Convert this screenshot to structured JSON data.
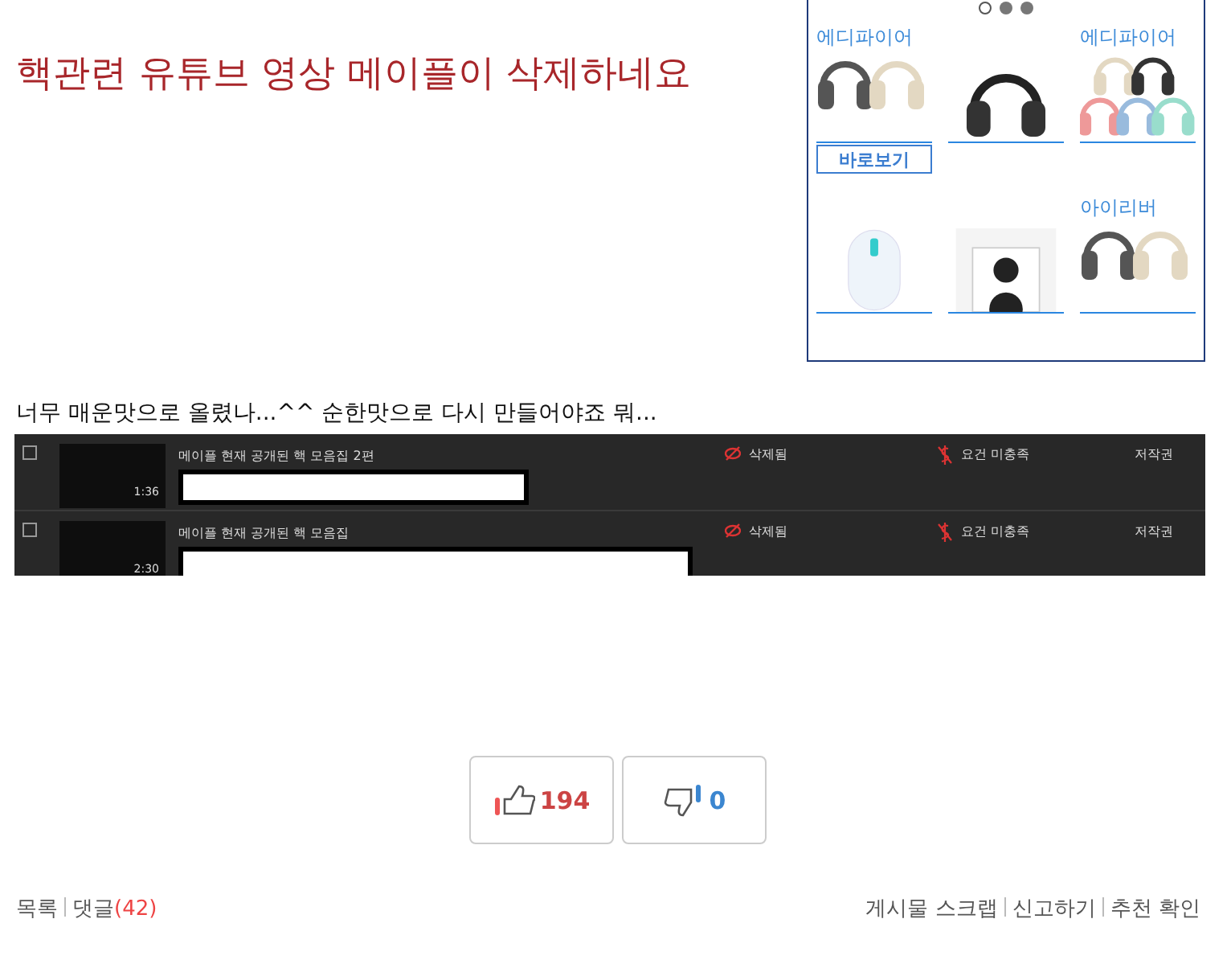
{
  "title": "핵관련 유튜브 영상 메이플이 삭제하네요",
  "ad": {
    "dots": [
      {
        "selected": true
      },
      {
        "selected": false
      },
      {
        "selected": false
      }
    ],
    "tiles": [
      {
        "label": "에디파이어",
        "kind": "headphones-pair",
        "button": "바로보기"
      },
      {
        "kind": "headphones"
      },
      {
        "label": "에디파이어",
        "kind": "headphones-set"
      },
      {
        "kind": "mouse"
      },
      {
        "kind": "speaker"
      },
      {
        "label": "아이리버",
        "kind": "headphones-pair"
      }
    ]
  },
  "caption": "너무 매운맛으로 올렸나...^^ 순한맛으로 다시 만들어야죠 뭐...",
  "videos": [
    {
      "checked": false,
      "duration": "1:36",
      "title": "메이플 현재 공개된 핵 모음집 2편",
      "status": "삭제됨",
      "restriction": "요건 미충족",
      "claim": "저작권"
    },
    {
      "checked": false,
      "duration": "2:30",
      "title": "메이플 현재 공개된 핵 모음집",
      "status": "삭제됨",
      "restriction": "요건 미충족",
      "claim": "저작권"
    }
  ],
  "votes": {
    "up": "194",
    "down": "0"
  },
  "footer": {
    "left": [
      {
        "label": "목록"
      },
      {
        "label": "댓글",
        "count": "(42)"
      }
    ],
    "right": [
      "게시물 스크랩",
      "신고하기",
      "추천 확인"
    ]
  }
}
